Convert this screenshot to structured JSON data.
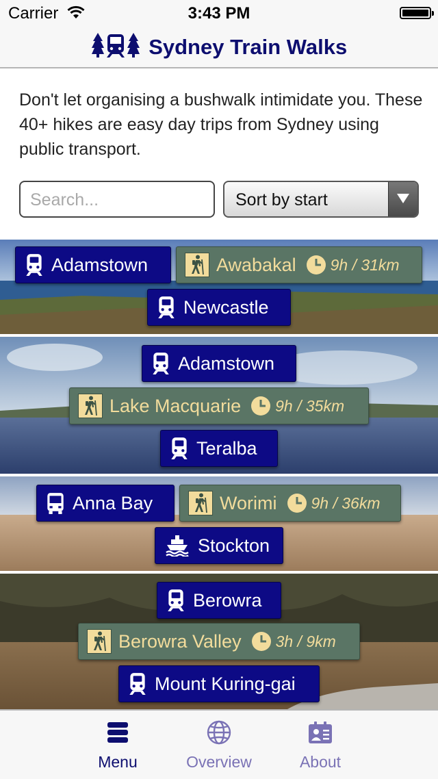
{
  "status_bar": {
    "carrier": "Carrier",
    "time": "3:43 PM"
  },
  "header": {
    "title": "Sydney Train Walks"
  },
  "intro": {
    "text": "Don't let organising a bushwalk intimidate you. These 40+ hikes are easy day trips from Sydney using public transport."
  },
  "search": {
    "placeholder": "Search...",
    "value": ""
  },
  "sort": {
    "selected": "Sort by start"
  },
  "walks": [
    {
      "start": "Adamstown",
      "start_icon": "train-icon",
      "track": "Awabakal",
      "duration": "9h / 31km",
      "end": "Newcastle",
      "end_icon": "train-icon"
    },
    {
      "start": "Adamstown",
      "start_icon": "train-icon",
      "track": "Lake Macquarie",
      "duration": "9h / 35km",
      "end": "Teralba",
      "end_icon": "train-icon"
    },
    {
      "start": "Anna Bay",
      "start_icon": "bus-icon",
      "track": "Worimi",
      "duration": "9h / 36km",
      "end": "Stockton",
      "end_icon": "ferry-icon"
    },
    {
      "start": "Berowra",
      "start_icon": "train-icon",
      "track": "Berowra Valley",
      "duration": "3h / 9km",
      "end": "Mount Kuring-gai",
      "end_icon": "train-icon"
    }
  ],
  "tabs": [
    {
      "label": "Menu",
      "icon": "menu-icon",
      "active": true
    },
    {
      "label": "Overview",
      "icon": "globe-icon",
      "active": false
    },
    {
      "label": "About",
      "icon": "contact-card-icon",
      "active": false
    }
  ],
  "colors": {
    "brand": "#0d0e6f",
    "station_chip": "#0d0a85",
    "track_chip": "#5a7565",
    "track_text": "#f2dc9c",
    "tab_active": "#0d0e6f",
    "tab_inactive": "#7a72b5"
  }
}
